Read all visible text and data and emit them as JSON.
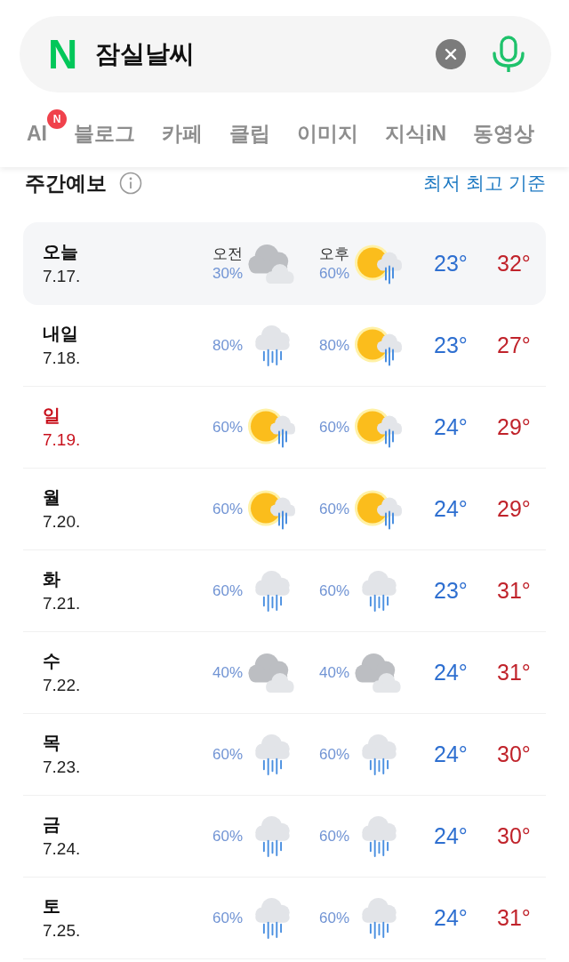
{
  "search": {
    "logo": "N",
    "value": "잠실날씨"
  },
  "tabs": [
    {
      "label": "AI",
      "badge": "N",
      "selected": false
    },
    {
      "label": "블로그",
      "selected": false
    },
    {
      "label": "카페",
      "selected": false
    },
    {
      "label": "클립",
      "selected": false
    },
    {
      "label": "이미지",
      "selected": false
    },
    {
      "label": "지식iN",
      "selected": false
    },
    {
      "label": "동영상",
      "selected": false
    }
  ],
  "forecast": {
    "title": "주간예보",
    "link": "최저 최고 기준",
    "rows": [
      {
        "day": "오늘",
        "date": "7.17.",
        "holiday": false,
        "highlighted": true,
        "periods": [
          {
            "label": "오전",
            "pop": "30%",
            "kind": "cloudy"
          },
          {
            "label": "오후",
            "pop": "60%",
            "kind": "showers"
          }
        ],
        "low": "23°",
        "high": "32°"
      },
      {
        "day": "내일",
        "date": "7.18.",
        "holiday": false,
        "highlighted": false,
        "periods": [
          {
            "pop": "80%",
            "kind": "rain"
          },
          {
            "pop": "80%",
            "kind": "showers"
          }
        ],
        "low": "23°",
        "high": "27°"
      },
      {
        "day": "일",
        "date": "7.19.",
        "holiday": true,
        "highlighted": false,
        "periods": [
          {
            "pop": "60%",
            "kind": "showers"
          },
          {
            "pop": "60%",
            "kind": "showers"
          }
        ],
        "low": "24°",
        "high": "29°"
      },
      {
        "day": "월",
        "date": "7.20.",
        "holiday": false,
        "highlighted": false,
        "periods": [
          {
            "pop": "60%",
            "kind": "showers"
          },
          {
            "pop": "60%",
            "kind": "showers"
          }
        ],
        "low": "24°",
        "high": "29°"
      },
      {
        "day": "화",
        "date": "7.21.",
        "holiday": false,
        "highlighted": false,
        "periods": [
          {
            "pop": "60%",
            "kind": "rain"
          },
          {
            "pop": "60%",
            "kind": "rain"
          }
        ],
        "low": "23°",
        "high": "31°"
      },
      {
        "day": "수",
        "date": "7.22.",
        "holiday": false,
        "highlighted": false,
        "periods": [
          {
            "pop": "40%",
            "kind": "cloudy"
          },
          {
            "pop": "40%",
            "kind": "cloudy"
          }
        ],
        "low": "24°",
        "high": "31°"
      },
      {
        "day": "목",
        "date": "7.23.",
        "holiday": false,
        "highlighted": false,
        "periods": [
          {
            "pop": "60%",
            "kind": "rain"
          },
          {
            "pop": "60%",
            "kind": "rain"
          }
        ],
        "low": "24°",
        "high": "30°"
      },
      {
        "day": "금",
        "date": "7.24.",
        "holiday": false,
        "highlighted": false,
        "periods": [
          {
            "pop": "60%",
            "kind": "rain"
          },
          {
            "pop": "60%",
            "kind": "rain"
          }
        ],
        "low": "24°",
        "high": "30°"
      },
      {
        "day": "토",
        "date": "7.25.",
        "holiday": false,
        "highlighted": false,
        "periods": [
          {
            "pop": "60%",
            "kind": "rain"
          },
          {
            "pop": "60%",
            "kind": "rain"
          }
        ],
        "low": "24°",
        "high": "31°"
      }
    ]
  }
}
